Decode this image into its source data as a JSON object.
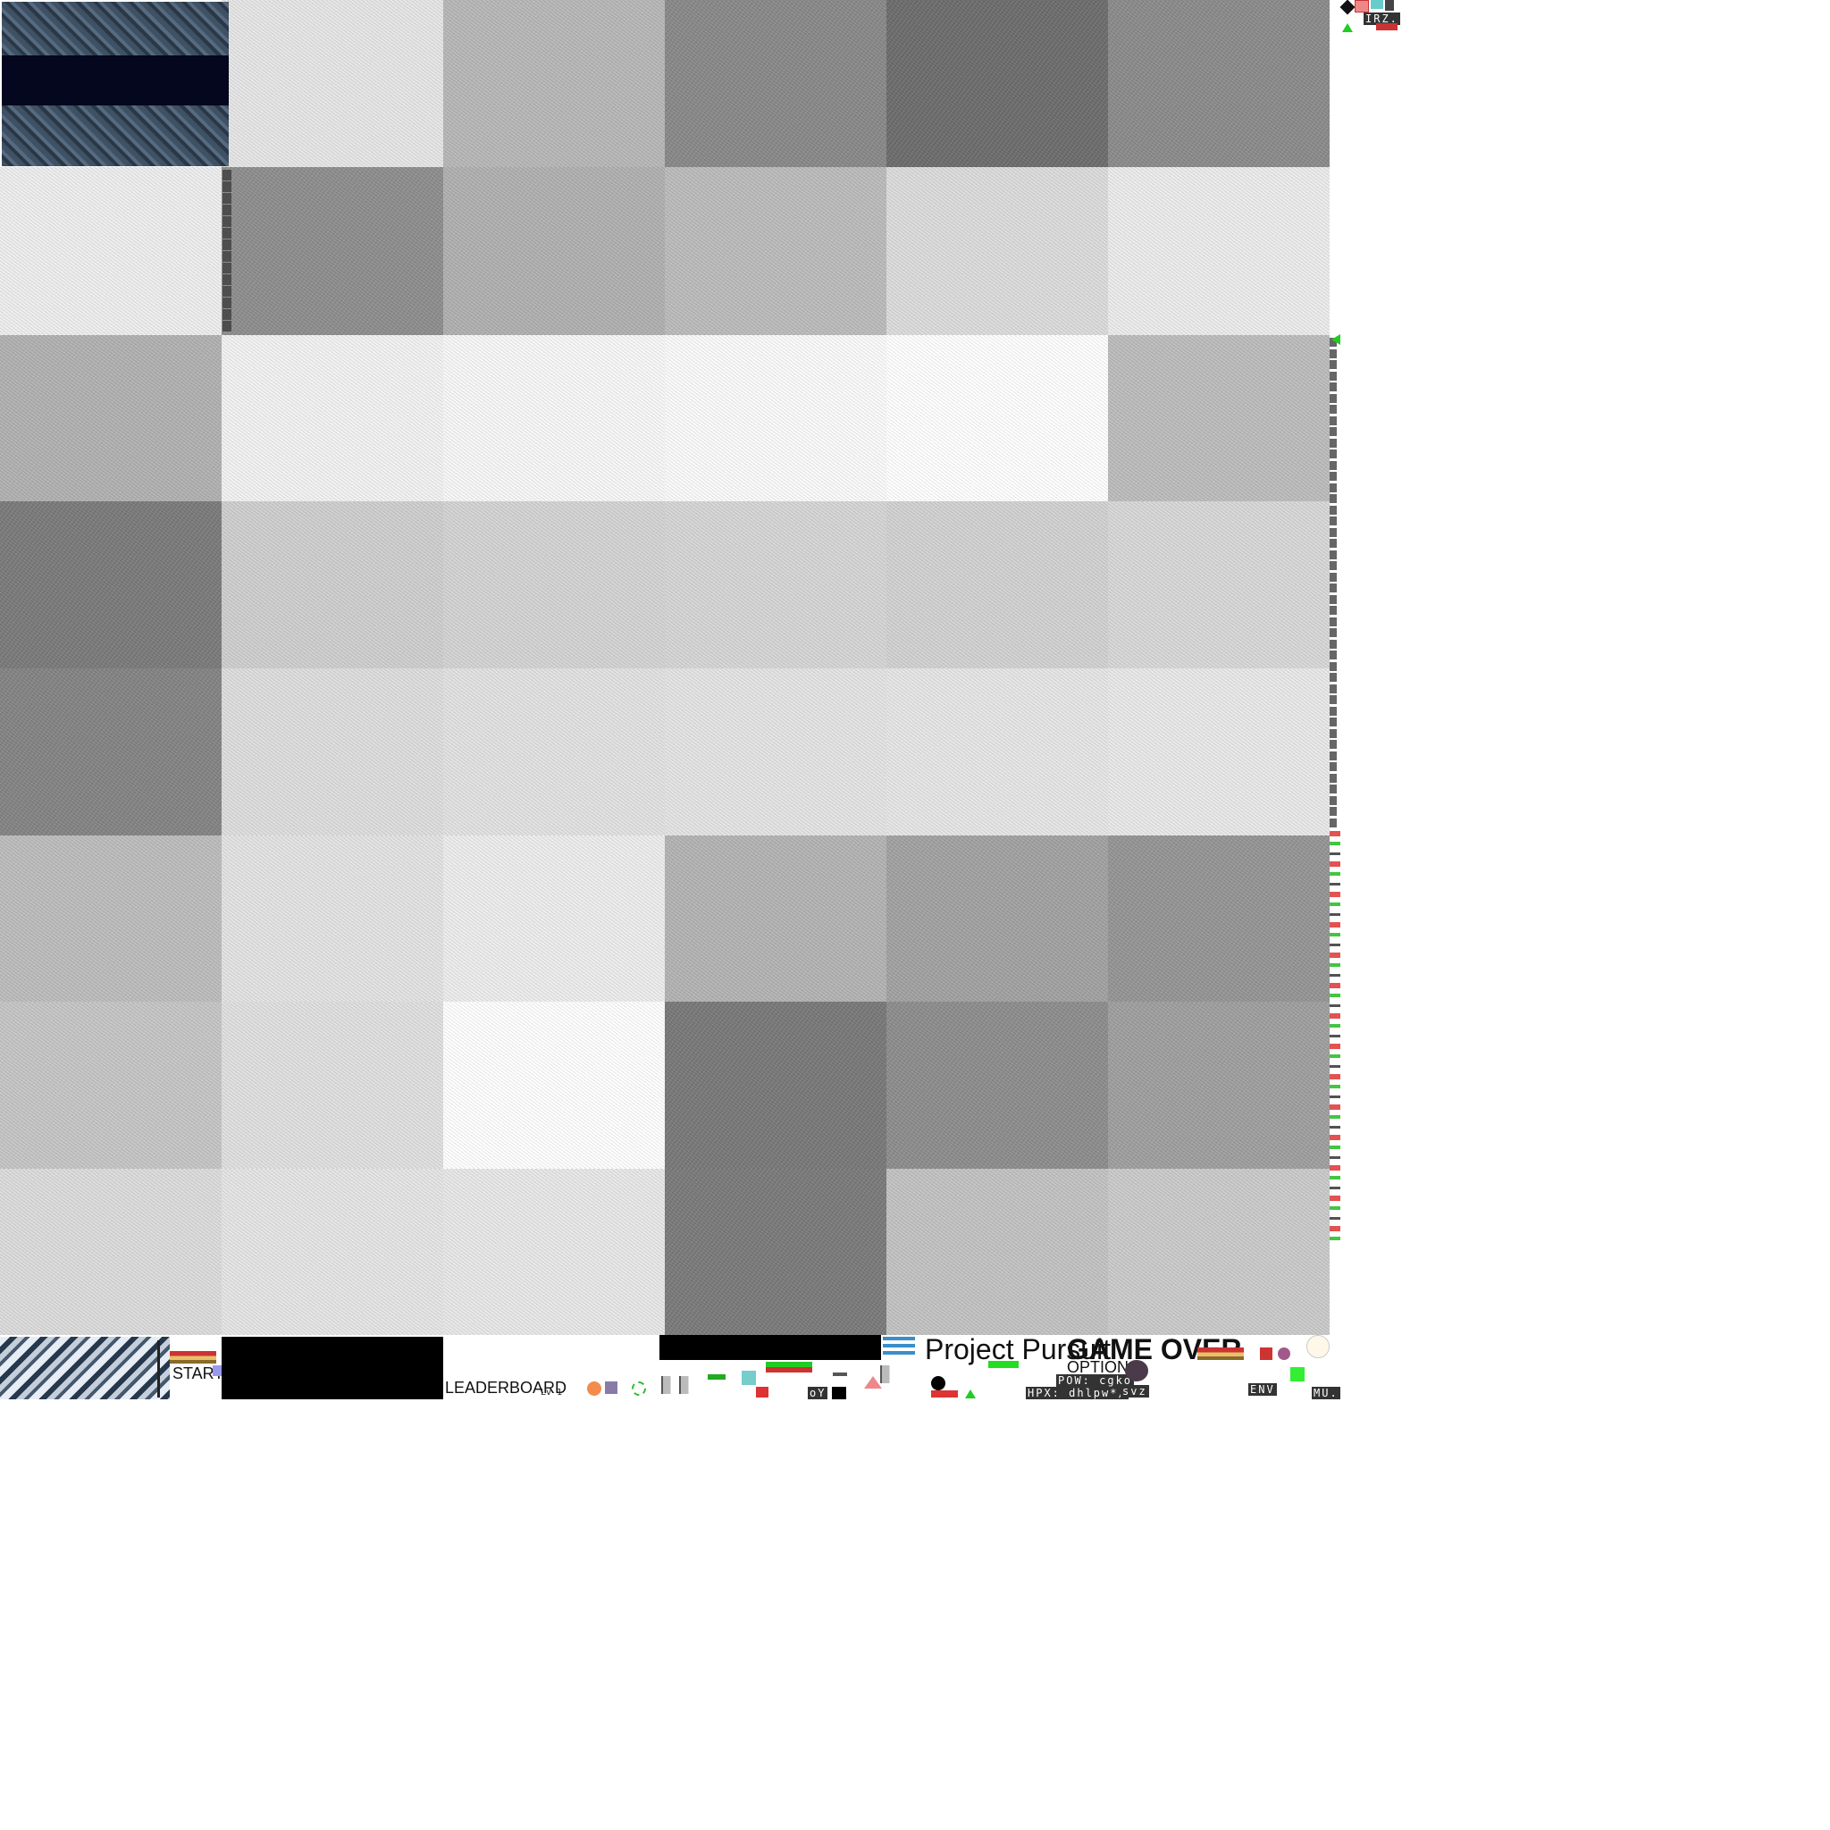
{
  "atlas": {
    "title": "Project Pursuit",
    "game_over": "GAME OVER",
    "start": "START",
    "options": "OPTIONS",
    "leaderboard": "LEADERBOARD",
    "level_small": "Lv 1",
    "pixel_strip_top": "IRZ.",
    "pixel_pow": "POW: cgko",
    "pixel_hpx": "HPX: dhlpw*/",
    "pixel_svz": "svz",
    "pixel_env": "ENV",
    "pixel_mu": "MU.",
    "pixel_oy": "oY"
  },
  "textures": {
    "row_colors": [
      [
        "#c9cdd1",
        "#e6e6e6",
        "#b8b8b8",
        "#8a8a8a",
        "#6e6e6e",
        "#8c8c8c"
      ],
      [
        "#eeeeee",
        "#8f8f8f",
        "#b1b1b1",
        "#bcbcbc",
        "#dcdcdc",
        "#ececec"
      ],
      [
        "#b2b2b2",
        "#f2f2f2",
        "#f7f7f7",
        "#fafafa",
        "#ffffff",
        "#bdbdbd"
      ],
      [
        "#7c7c7c",
        "#cfcfcf",
        "#d4d4d4",
        "#d6d6d6",
        "#d2d2d2",
        "#d8d8d8"
      ],
      [
        "#858585",
        "#dedede",
        "#e2e2e2",
        "#e4e4e4",
        "#e6e6e6",
        "#e9e9e9"
      ],
      [
        "#bdbdbd",
        "#e3e3e3",
        "#ededed",
        "#b4b4b4",
        "#a3a3a3",
        "#969696"
      ],
      [
        "#c6c6c6",
        "#e0e0e0",
        "#ffffff",
        "#7a7a7a",
        "#8e8e8e",
        "#a0a0a0"
      ],
      [
        "#dcdcdc",
        "#e5e5e5",
        "#e8e8e8",
        "#7c7c7c",
        "#c3c3c3",
        "#cbcbcb"
      ]
    ],
    "night_band_color": "#04071e",
    "rock_color": "#3f5164"
  }
}
